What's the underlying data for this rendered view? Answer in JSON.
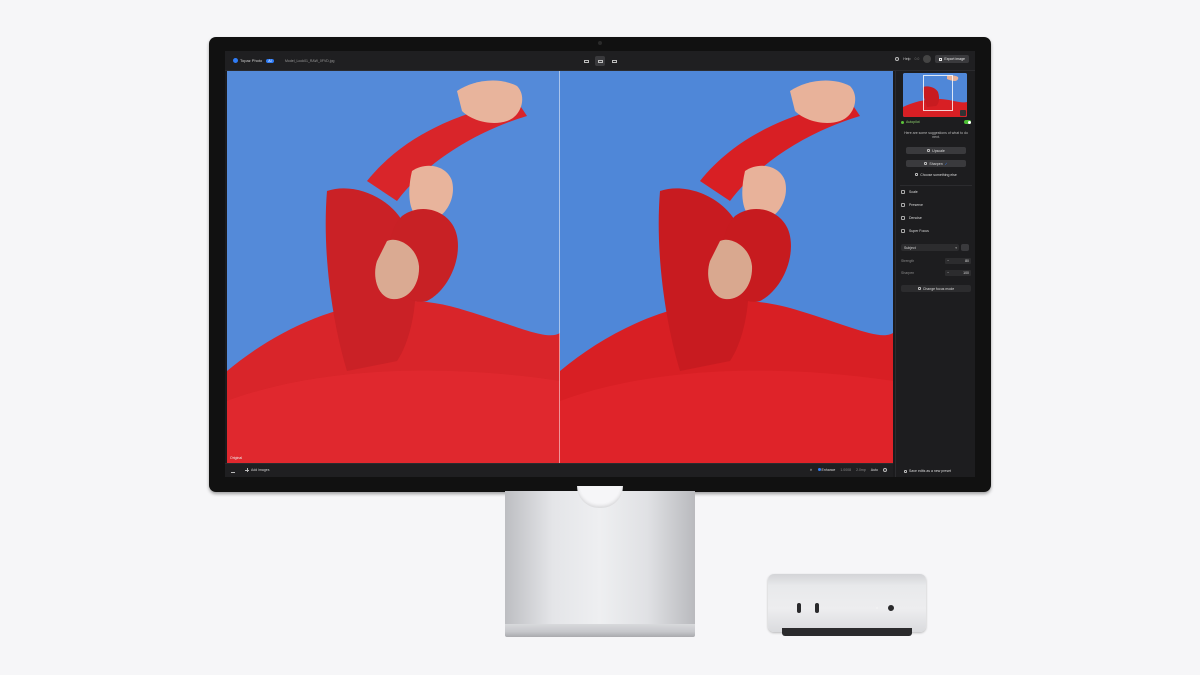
{
  "app": {
    "name": "Topaz Photo",
    "badge": "AI",
    "filename": "Model_Look01_RAW_0FVD.jpg"
  },
  "topbar": {
    "help_label": "Help",
    "undo_label": "0.0",
    "export_label": "Export image"
  },
  "canvas": {
    "original_label": "Original"
  },
  "bottombar": {
    "add_images_label": "Add images",
    "enhance_label": "Enhance",
    "stat1": "1.0008",
    "stat2": "2.0mp",
    "zoom": "Auto",
    "close_glyph": "✕"
  },
  "panel": {
    "autopilot_label": "Autopilot",
    "suggestions_text": "Here are some suggestions of what to do next.",
    "buttons": [
      {
        "label": "Upscale"
      },
      {
        "label": "Sharpen",
        "check": "✓"
      }
    ],
    "choose_label": "Choose something else",
    "tools": [
      {
        "label": "Scale"
      },
      {
        "label": "Preserve"
      },
      {
        "label": "Denoise"
      },
      {
        "label": "Super Focus"
      }
    ],
    "select_value": "Subject",
    "strength_label": "Strength",
    "strength_value": "80",
    "detail_label": "Sharpen",
    "detail_value": "100",
    "change_focus_label": "Change focus mode",
    "save_preset_label": "Save edits as a new preset"
  },
  "colors": {
    "accent": "#2f7cf6",
    "autopilot_green": "#5cc43a",
    "sky": "#4f87d8",
    "dress_red": "#d81f24"
  }
}
